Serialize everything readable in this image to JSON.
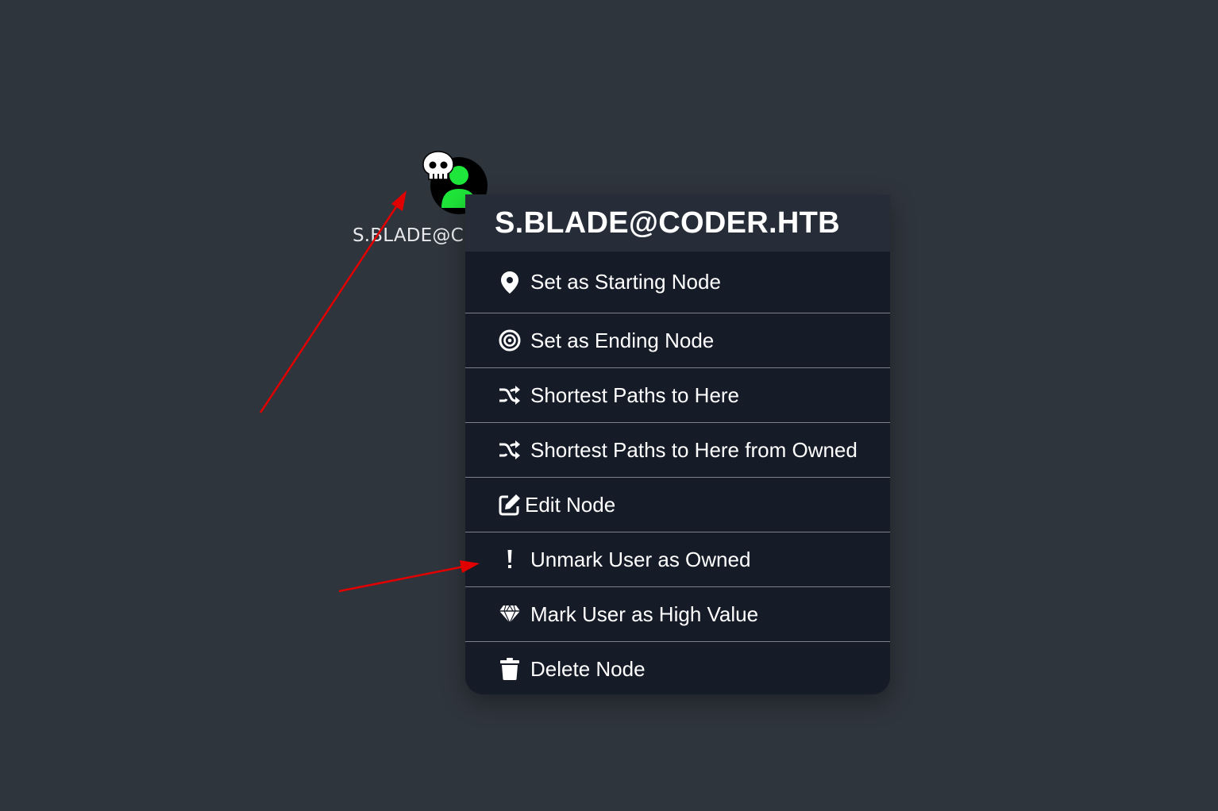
{
  "node": {
    "label": "S.BLADE@C",
    "icon": "user-icon",
    "badge_icon": "skull-icon",
    "colors": {
      "circle": "#000000",
      "user": "#1fe63a",
      "skull": "#ffffff"
    }
  },
  "context_menu": {
    "title": "S.BLADE@CODER.HTB",
    "items": [
      {
        "label": "Set as Starting Node",
        "icon": "map-marker-icon"
      },
      {
        "label": "Set as Ending Node",
        "icon": "bullseye-icon"
      },
      {
        "label": "Shortest Paths to Here",
        "icon": "shuffle-icon"
      },
      {
        "label": "Shortest Paths to Here from Owned",
        "icon": "shuffle-icon"
      },
      {
        "label": "Edit Node",
        "icon": "edit-icon"
      },
      {
        "label": "Unmark User as Owned",
        "icon": "exclamation-icon"
      },
      {
        "label": "Mark User as High Value",
        "icon": "diamond-icon"
      },
      {
        "label": "Delete Node",
        "icon": "trash-icon"
      }
    ]
  },
  "colors": {
    "background": "#2f353d",
    "menu_bg": "#151b27",
    "menu_header_bg": "#262c38",
    "arrow": "#e00000"
  }
}
